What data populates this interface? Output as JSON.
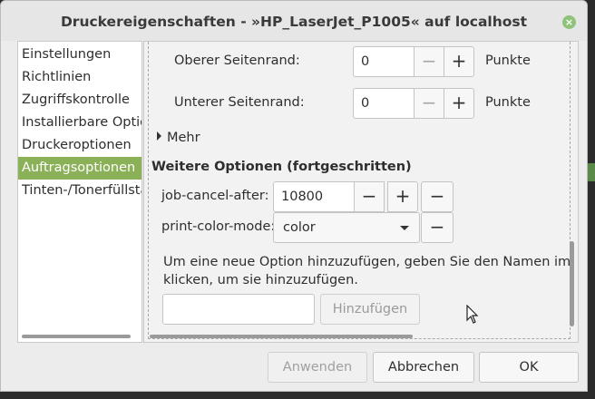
{
  "window": {
    "title": "Druckereigenschaften - »HP_LaserJet_P1005« auf localhost",
    "close_glyph": "×"
  },
  "sidebar": {
    "items": [
      {
        "label": "Einstellungen"
      },
      {
        "label": "Richtlinien"
      },
      {
        "label": "Zugriffskontrolle"
      },
      {
        "label": "Installierbare Optionen"
      },
      {
        "label": "Druckeroptionen"
      },
      {
        "label": "Auftragsoptionen",
        "selected": true
      },
      {
        "label": "Tinten-/Tonerfüllstand"
      }
    ]
  },
  "margins": {
    "top_label": "Oberer Seitenrand:",
    "top_value": "0",
    "bottom_label": "Unterer Seitenrand:",
    "bottom_value": "0",
    "unit": "Punkte",
    "minus": "−",
    "plus": "+"
  },
  "more_label": "Mehr",
  "advanced": {
    "heading": "Weitere Optionen (fortgeschritten)",
    "job_cancel_label": "job-cancel-after:",
    "job_cancel_value": "10800",
    "color_mode_label": "print-color-mode:",
    "color_mode_value": "color",
    "remove": "−",
    "info_line1": "Um eine neue Option hinzuzufügen, geben Sie den Namen im",
    "info_line2": "klicken, um sie hinzuzufügen.",
    "add_button": "Hinzufügen"
  },
  "buttons": {
    "apply": "Anwenden",
    "cancel": "Abbrechen",
    "ok": "OK"
  },
  "colors": {
    "selection": "#8bb158",
    "close_button": "#8fc37a"
  }
}
